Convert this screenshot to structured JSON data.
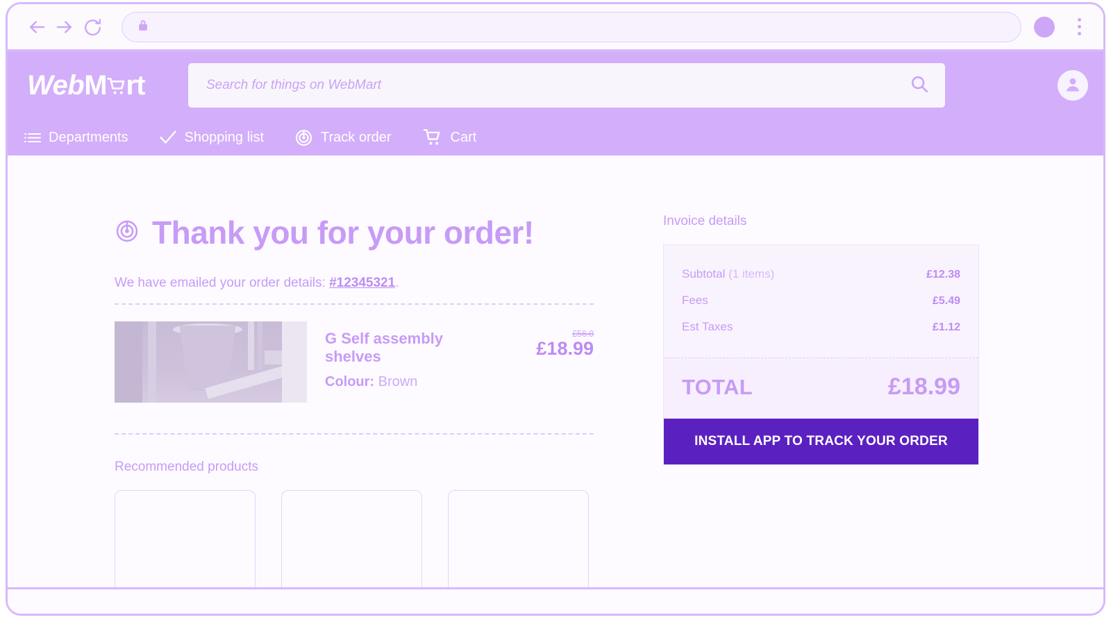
{
  "browser": {
    "back_icon": "arrow-left-icon",
    "forward_icon": "arrow-right-icon",
    "reload_icon": "reload-icon",
    "lock_icon": "lock-icon",
    "url_value": "",
    "profile_icon": "profile-dot-icon",
    "menu_icon": "kebab-menu-icon"
  },
  "header": {
    "brand": {
      "part1": "Web",
      "part2": "M",
      "cart_icon": "shopping-cart-icon",
      "part3": "rt"
    },
    "search": {
      "placeholder": "Search for things on WebMart",
      "value": "",
      "search_icon": "search-icon"
    },
    "account_icon": "user-account-icon",
    "nav": [
      {
        "label": "Departments",
        "icon": "list-menu-icon"
      },
      {
        "label": "Shopping list",
        "icon": "check-icon"
      },
      {
        "label": "Track order",
        "icon": "radar-target-icon"
      },
      {
        "label": "Cart",
        "icon": "shopping-cart-icon"
      }
    ]
  },
  "main": {
    "heading_icon": "radar-target-icon",
    "heading": "Thank you for your order!",
    "order_intro": "We have emailed your order details: ",
    "order_id": "#12345321",
    "order_outro": ".",
    "product": {
      "image_alt": "product-photo",
      "title": "G Self assembly shelves",
      "colour_label": "Colour:",
      "colour_value": "Brown",
      "old_price": "£56.0",
      "price": "£18.99"
    },
    "recommended_title": "Recommended products",
    "recommended_cards": [
      "",
      "",
      ""
    ]
  },
  "invoice": {
    "title": "Invoice details",
    "lines": [
      {
        "label": "Subtotal",
        "sublabel": " (1 items)",
        "value": "£12.38"
      },
      {
        "label": "Fees",
        "sublabel": "",
        "value": "£5.49"
      },
      {
        "label": "Est Taxes",
        "sublabel": "",
        "value": "£1.12"
      }
    ],
    "total_label": "TOTAL",
    "total_value": "£18.99",
    "install_button": "INSTALL APP TO TRACK YOUR ORDER"
  },
  "colors": {
    "brand_purple": "#d3aefa",
    "accent_lilac": "#c79bf6",
    "deep_purple": "#5b21c0",
    "page_bg": "#fdfbff",
    "card_bg": "#f9f3fe",
    "frame_border": "#d9b8fb"
  }
}
